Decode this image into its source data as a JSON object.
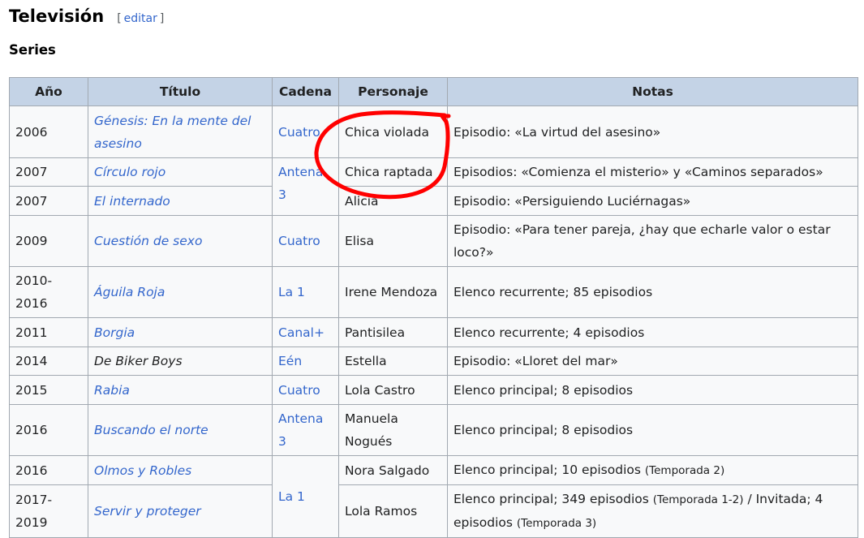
{
  "section": {
    "title": "Televisión",
    "edit_open": "[",
    "edit_label": "editar",
    "edit_close": "]",
    "subtitle": "Series"
  },
  "table": {
    "headers": [
      "Año",
      "Título",
      "Cadena",
      "Personaje",
      "Notas"
    ],
    "rows": [
      {
        "year": "2006",
        "title": "Génesis: En la mente del asesino",
        "channel": "Cuatro",
        "character": "Chica violada",
        "notes": [
          {
            "t": "Episodio: «La virtud del asesino»"
          }
        ]
      },
      {
        "year": "2007",
        "title": "Círculo rojo",
        "channel": "Antena 3",
        "character": "Chica raptada",
        "notes": [
          {
            "t": "Episodios: «Comienza el misterio» y «Caminos separados»"
          }
        ]
      },
      {
        "year": "2007",
        "title": "El internado",
        "channel": null,
        "character": "Alicia",
        "notes": [
          {
            "t": "Episodio: «Persiguiendo Luciérnagas»"
          }
        ]
      },
      {
        "year": "2009",
        "title": "Cuestión de sexo",
        "channel": "Cuatro",
        "character": "Elisa",
        "notes": [
          {
            "t": "Episodio: «Para tener pareja, ¿hay que echarle valor o estar loco?»"
          }
        ]
      },
      {
        "year": "2010-2016",
        "title": "Águila Roja",
        "channel": "La 1",
        "character": "Irene Mendoza",
        "notes": [
          {
            "t": "Elenco recurrente; 85 episodios"
          }
        ]
      },
      {
        "year": "2011",
        "title": "Borgia",
        "channel": "Canal+",
        "character": "Pantisilea",
        "notes": [
          {
            "t": "Elenco recurrente; 4 episodios"
          }
        ]
      },
      {
        "year": "2014",
        "title": "De Biker Boys",
        "title_link": false,
        "channel": "Eén",
        "character": "Estella",
        "notes": [
          {
            "t": "Episodio: «Lloret del mar»"
          }
        ]
      },
      {
        "year": "2015",
        "title": "Rabia",
        "channel": "Cuatro",
        "character": "Lola Castro",
        "notes": [
          {
            "t": "Elenco principal; 8 episodios"
          }
        ]
      },
      {
        "year": "2016",
        "title": "Buscando el norte",
        "channel": "Antena 3",
        "character": "Manuela Nogués",
        "notes": [
          {
            "t": "Elenco principal; 8 episodios"
          }
        ]
      },
      {
        "year": "2016",
        "title": "Olmos y Robles",
        "channel": "La 1",
        "character": "Nora Salgado",
        "notes": [
          {
            "t": "Elenco principal; 10 episodios "
          },
          {
            "t": "(Temporada 2)",
            "small": true
          }
        ]
      },
      {
        "year": "2017-2019",
        "title": "Servir y proteger",
        "channel": null,
        "character": "Lola Ramos",
        "notes": [
          {
            "t": "Elenco principal; 349 episodios "
          },
          {
            "t": "(Temporada 1-2)",
            "small": true
          },
          {
            "t": " / Invitada; 4 episodios "
          },
          {
            "t": "(Temporada 3)",
            "small": true
          }
        ]
      }
    ]
  },
  "annotation_color": "#ff0000"
}
